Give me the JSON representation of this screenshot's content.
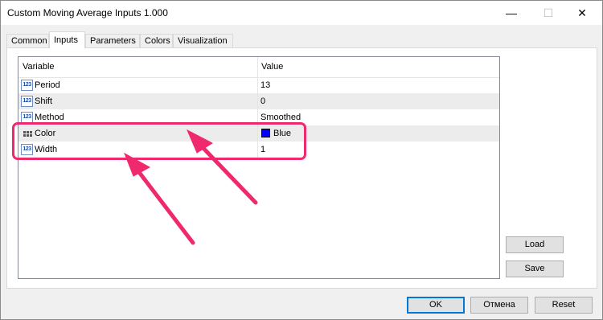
{
  "window": {
    "title": "Custom Moving Average Inputs 1.000",
    "minimize": "—",
    "maximize": "☐",
    "close": "✕"
  },
  "tabs": [
    {
      "label": "Common"
    },
    {
      "label": "Inputs",
      "active": true
    },
    {
      "label": "Parameters"
    },
    {
      "label": "Colors"
    },
    {
      "label": "Visualization"
    }
  ],
  "grid": {
    "headers": {
      "variable": "Variable",
      "value": "Value"
    },
    "rows": [
      {
        "icon": "int-123-icon",
        "variable": "Period",
        "value": "13"
      },
      {
        "icon": "int-123-icon",
        "variable": "Shift",
        "value": "0"
      },
      {
        "icon": "int-123-icon",
        "variable": "Method",
        "value": "Smoothed"
      },
      {
        "icon": "color-palette-icon",
        "variable": "Color",
        "value": "Blue",
        "swatch": "#0000ff"
      },
      {
        "icon": "int-123-icon",
        "variable": "Width",
        "value": "1"
      }
    ],
    "icon_text": "123"
  },
  "side_buttons": {
    "load": "Load",
    "save": "Save"
  },
  "footer_buttons": {
    "ok": "OK",
    "cancel": "Отмена",
    "reset": "Reset"
  },
  "annotation": {
    "color": "#f0286e"
  }
}
